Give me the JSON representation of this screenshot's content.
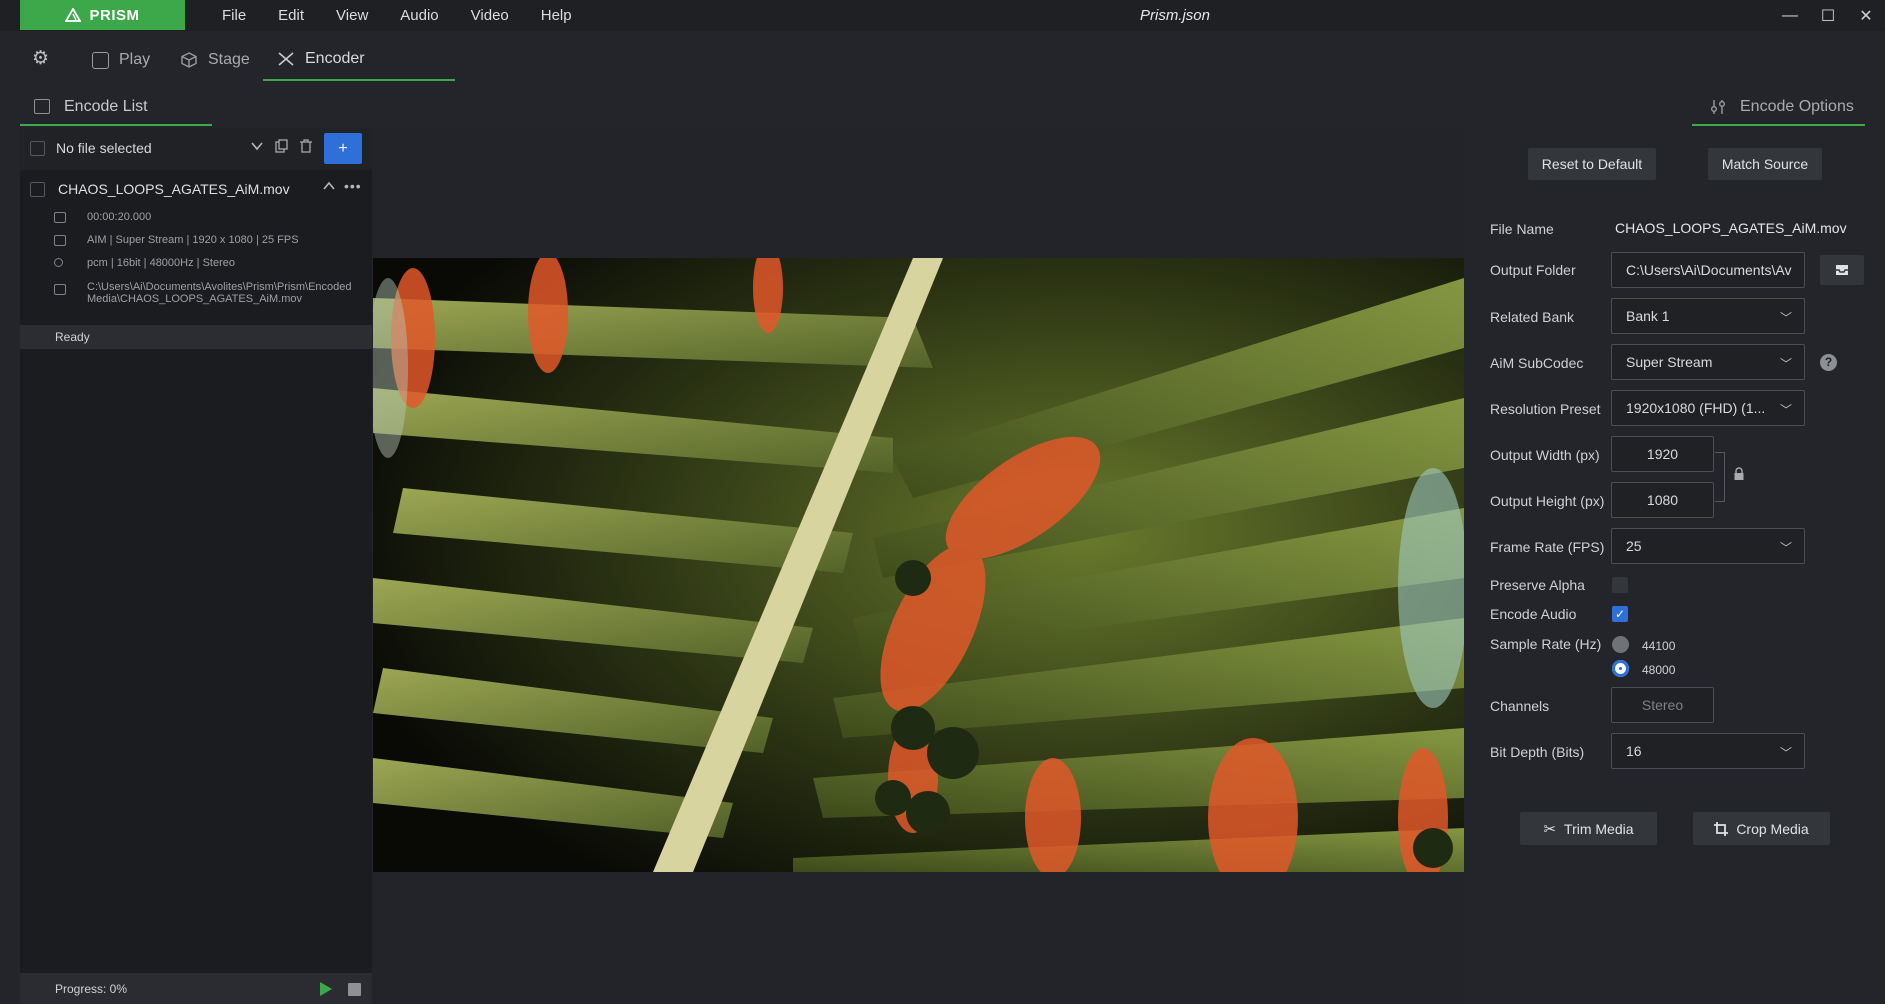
{
  "app": {
    "logo_text": "PRISM",
    "window_title": "Prism.json",
    "accent": "#3da84a",
    "blue": "#2e6fd8"
  },
  "menu": [
    "File",
    "Edit",
    "View",
    "Audio",
    "Video",
    "Help"
  ],
  "window_controls": {
    "minimize": "—",
    "maximize": "☐",
    "close": "✕"
  },
  "tabs": {
    "play": "Play",
    "stage": "Stage",
    "encoder": "Encoder"
  },
  "panels": {
    "encode_list": "Encode List",
    "encode_options": "Encode Options"
  },
  "list_toolbar": {
    "selection_label": "No file selected",
    "add_label": "+"
  },
  "file": {
    "name": "CHAOS_LOOPS_AGATES_AiM.mov",
    "duration": "00:00:20.000",
    "video_info": "AIM | Super Stream | 1920 x 1080 | 25 FPS",
    "audio_info": "pcm | 16bit | 48000Hz | Stereo",
    "path_line1": "C:\\Users\\Ai\\Documents\\Avolites\\Prism\\Prism\\Encoded",
    "path_line2": "Media\\CHAOS_LOOPS_AGATES_AiM.mov"
  },
  "status": {
    "ready": "Ready",
    "progress": "Progress: 0%",
    "progress_value": 0
  },
  "options": {
    "reset_label": "Reset to Default",
    "match_label": "Match Source",
    "file_name_label": "File Name",
    "file_name_value": "CHAOS_LOOPS_AGATES_AiM.mov",
    "output_folder_label": "Output Folder",
    "output_folder_value": "C:\\Users\\Ai\\Documents\\Av",
    "related_bank_label": "Related Bank",
    "related_bank_value": "Bank 1",
    "subcodec_label": "AiM SubCodec",
    "subcodec_value": "Super Stream",
    "resolution_label": "Resolution Preset",
    "resolution_value": "1920x1080 (FHD) (1...",
    "width_label": "Output Width (px)",
    "width_value": "1920",
    "height_label": "Output Height (px)",
    "height_value": "1080",
    "fps_label": "Frame Rate (FPS)",
    "fps_value": "25",
    "alpha_label": "Preserve Alpha",
    "alpha_checked": false,
    "audio_label": "Encode Audio",
    "audio_checked": true,
    "sample_rate_label": "Sample Rate (Hz)",
    "sample_rate_options": [
      "44100",
      "48000"
    ],
    "sample_rate_selected": "48000",
    "channels_label": "Channels",
    "channels_value": "Stereo",
    "bit_depth_label": "Bit Depth (Bits)",
    "bit_depth_value": "16",
    "trim_label": "Trim Media",
    "crop_label": "Crop Media"
  }
}
